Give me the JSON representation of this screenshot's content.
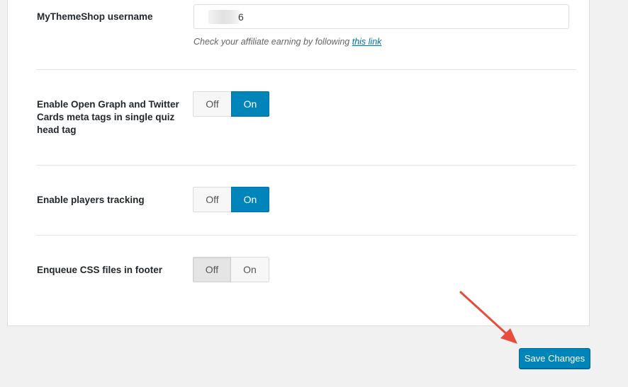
{
  "settings": {
    "username": {
      "label": "MyThemeShop username",
      "value": "6",
      "help_text": "Check your affiliate earning by following ",
      "help_link": "this link"
    },
    "open_graph": {
      "label": "Enable Open Graph and Twitter Cards meta tags in single quiz head tag",
      "off": "Off",
      "on": "On",
      "state": "On"
    },
    "players_tracking": {
      "label": "Enable players tracking",
      "off": "Off",
      "on": "On",
      "state": "On"
    },
    "css_footer": {
      "label": "Enqueue CSS files in footer",
      "off": "Off",
      "on": "On",
      "state": "Off"
    }
  },
  "footer": {
    "save_label": "Save Changes"
  },
  "colors": {
    "accent": "#0085ba",
    "annotation_arrow": "#e74c3c"
  }
}
